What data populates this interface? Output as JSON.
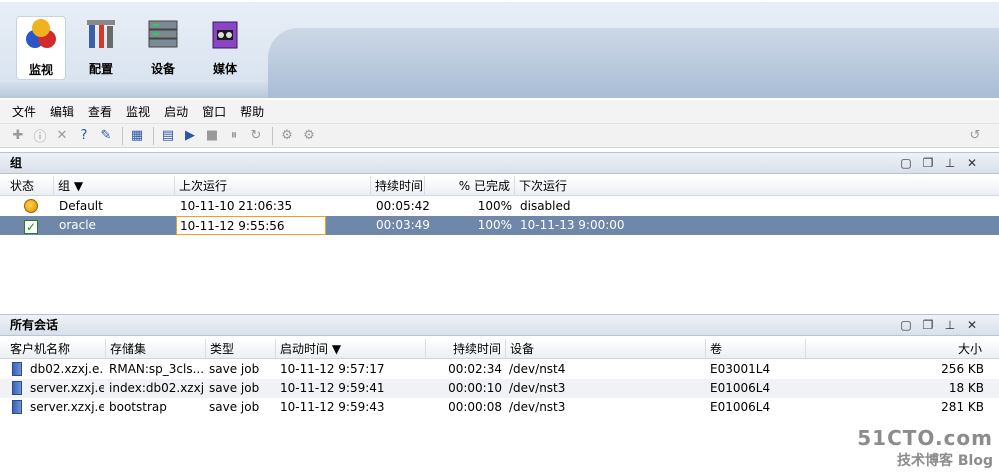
{
  "ribbon": {
    "buttons": [
      {
        "label": "监视",
        "icon": "monitor-icon"
      },
      {
        "label": "配置",
        "icon": "config-icon"
      },
      {
        "label": "设备",
        "icon": "device-icon"
      },
      {
        "label": "媒体",
        "icon": "media-icon"
      }
    ]
  },
  "menu": [
    "文件",
    "编辑",
    "查看",
    "监视",
    "启动",
    "窗口",
    "帮助"
  ],
  "groups_panel": {
    "title": "组",
    "columns": [
      "状态",
      "组",
      "上次运行",
      "持续时间",
      "% 已完成",
      "下次运行"
    ],
    "rows": [
      {
        "status": "warning",
        "group": "Default",
        "last_run": "10-11-10 21:06:35",
        "duration": "00:05:42",
        "completed": "100%",
        "next_run": "disabled"
      },
      {
        "status": "ok",
        "group": "oracle",
        "last_run": "10-11-12 9:55:56",
        "duration": "00:03:49",
        "completed": "100%",
        "next_run": "10-11-13 9:00:00"
      }
    ]
  },
  "sessions_panel": {
    "title": "所有会话",
    "columns": [
      "客户机名称",
      "存储集",
      "类型",
      "启动时间",
      "持续时间",
      "设备",
      "卷",
      "大小"
    ],
    "rows": [
      {
        "client": "db02.xzxj.e...",
        "saveset": "RMAN:sp_3cls...",
        "type": "save job",
        "start": "10-11-12 9:57:17",
        "duration": "00:02:34",
        "device": "/dev/nst4",
        "volume": "E03001L4",
        "size": "256 KB"
      },
      {
        "client": "server.xzxj.e...",
        "saveset": "index:db02.xzxj....",
        "type": "save job",
        "start": "10-11-12 9:59:41",
        "duration": "00:00:10",
        "device": "/dev/nst3",
        "volume": "E01006L4",
        "size": "18 KB"
      },
      {
        "client": "server.xzxj.e...",
        "saveset": "bootstrap",
        "type": "save job",
        "start": "10-11-12 9:59:43",
        "duration": "00:00:08",
        "device": "/dev/nst3",
        "volume": "E01006L4",
        "size": "281 KB"
      }
    ]
  },
  "watermark": {
    "line1": "51CTO.com",
    "line2": "技术博客",
    "line3": "Blog"
  }
}
